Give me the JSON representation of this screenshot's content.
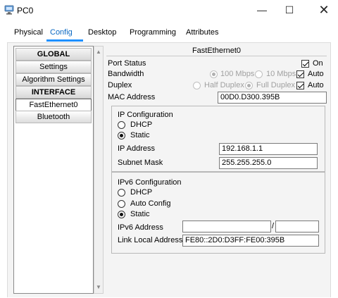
{
  "window": {
    "title": "PC0",
    "minimize_glyph": "—",
    "maximize_glyph": "☐",
    "close_glyph": "✕"
  },
  "tabs": [
    {
      "label": "Physical"
    },
    {
      "label": "Config"
    },
    {
      "label": "Desktop"
    },
    {
      "label": "Programming"
    },
    {
      "label": "Attributes"
    }
  ],
  "active_tab": "Config",
  "left_menu": {
    "global_header": "GLOBAL",
    "settings": "Settings",
    "algorithm_settings": "Algorithm Settings",
    "interface_header": "INTERFACE",
    "fastethernet0": "FastEthernet0",
    "bluetooth": "Bluetooth"
  },
  "panel": {
    "title": "FastEthernet0",
    "port_status": {
      "label": "Port Status",
      "on_label": "On",
      "checked": true
    },
    "bandwidth": {
      "label": "Bandwidth",
      "opt_100": "100 Mbps",
      "opt_10": "10 Mbps",
      "auto_label": "Auto",
      "auto_checked": true
    },
    "duplex": {
      "label": "Duplex",
      "opt_half": "Half Duplex",
      "opt_full": "Full Duplex",
      "auto_label": "Auto",
      "auto_checked": true
    },
    "mac": {
      "label": "MAC Address",
      "value": "00D0.D300.395B"
    },
    "ipv4": {
      "title": "IP Configuration",
      "dhcp": "DHCP",
      "static": "Static",
      "selected": "Static",
      "ip_label": "IP Address",
      "ip_value": "192.168.1.1",
      "mask_label": "Subnet Mask",
      "mask_value": "255.255.255.0"
    },
    "ipv6": {
      "title": "IPv6 Configuration",
      "dhcp": "DHCP",
      "auto_config": "Auto Config",
      "static": "Static",
      "selected": "Static",
      "addr_label": "IPv6 Address",
      "addr_value": "",
      "prefix_sep": "/",
      "prefix_value": "",
      "link_local_label": "Link Local Address:",
      "link_local_value": "FE80::2D0:D3FF:FE00:395B"
    }
  },
  "colors": {
    "active_tab": "#0a68c2",
    "tab_underline": "#1e90ff"
  },
  "icons": {
    "app": "pc-icon"
  }
}
